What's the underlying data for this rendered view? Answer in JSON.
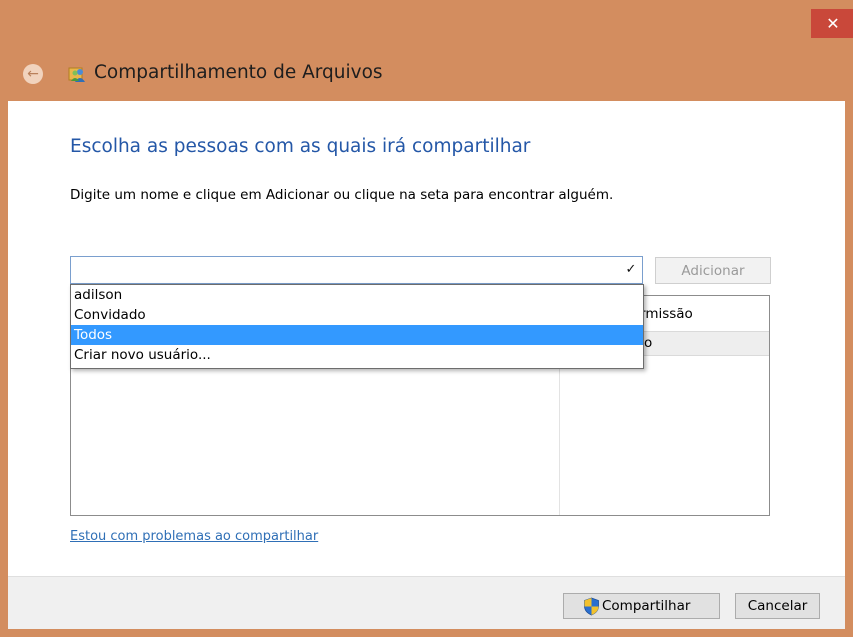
{
  "window": {
    "title": "Compartilhamento de Arquivos",
    "close_label": "✕",
    "back_label": "←",
    "frame_color": "#d38d5f"
  },
  "main": {
    "heading": "Escolha as pessoas com as quais irá compartilhar",
    "instruction": "Digite um nome e clique em Adicionar ou clique na seta para encontrar alguém.",
    "name_input": {
      "value": "",
      "placeholder": ""
    },
    "add_button": "Adicionar",
    "permission_header": "Permissão",
    "permission_row_fragment": "o",
    "permission_header_visible": "rmissão",
    "help_link": "Estou com problemas ao compartilhar"
  },
  "dropdown": {
    "options": [
      "adilson",
      "Convidado",
      "Todos",
      "Criar novo usuário..."
    ],
    "selected_index": 2
  },
  "footer": {
    "share_button": "Compartilhar",
    "cancel_button": "Cancelar"
  },
  "colors": {
    "heading": "#2457a7",
    "link": "#2f6fb6",
    "selection": "#3399ff"
  }
}
